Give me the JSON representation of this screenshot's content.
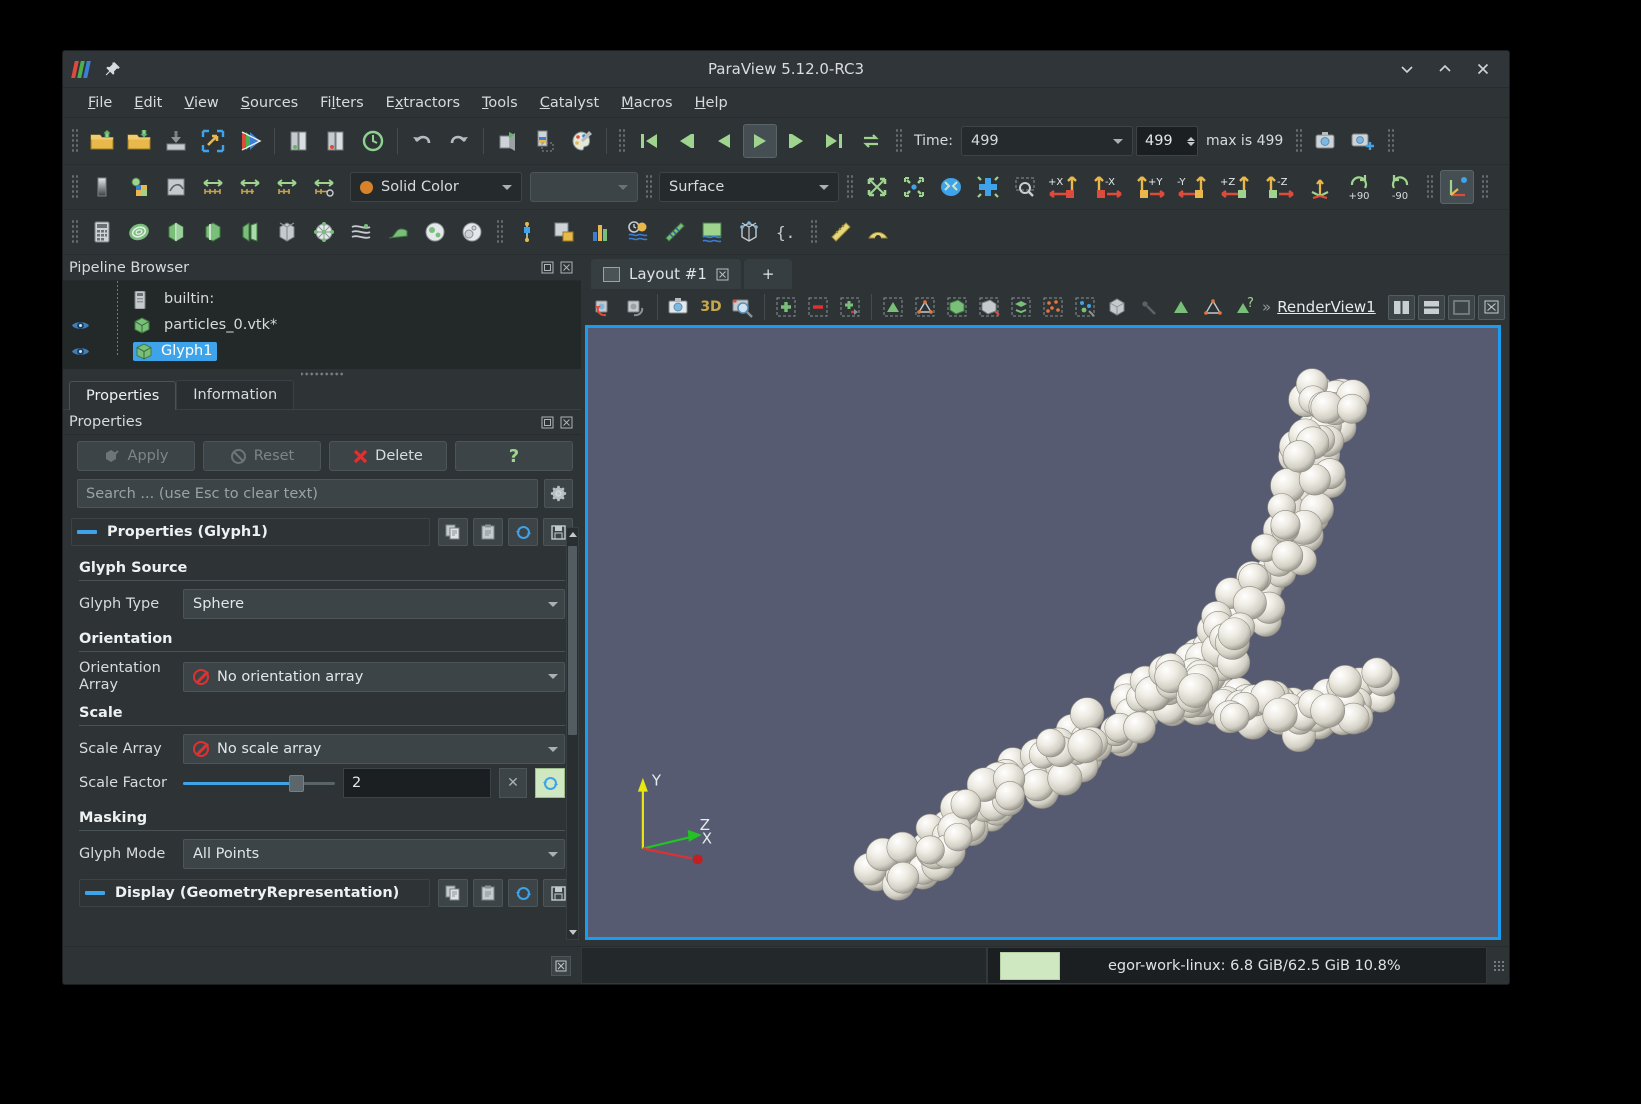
{
  "window": {
    "title": "ParaView 5.12.0-RC3",
    "logo_colors": [
      "#e04a3a",
      "#4bb050",
      "#3a7fd5"
    ],
    "pin_icon": "pin-icon",
    "controls": [
      {
        "name": "minimize-button",
        "glyph": "⌵"
      },
      {
        "name": "maximize-button",
        "glyph": "⌃"
      },
      {
        "name": "close-button",
        "glyph": "✕"
      }
    ]
  },
  "menubar": {
    "items": [
      {
        "label": "File",
        "mnemonic": "F"
      },
      {
        "label": "Edit",
        "mnemonic": "E"
      },
      {
        "label": "View",
        "mnemonic": "V"
      },
      {
        "label": "Sources",
        "mnemonic": "S"
      },
      {
        "label": "Filters",
        "mnemonic": "l"
      },
      {
        "label": "Extractors",
        "mnemonic": "x"
      },
      {
        "label": "Tools",
        "mnemonic": "T"
      },
      {
        "label": "Catalyst",
        "mnemonic": "C"
      },
      {
        "label": "Macros",
        "mnemonic": "M"
      },
      {
        "label": "Help",
        "mnemonic": "H"
      }
    ]
  },
  "toolbar_main": {
    "buttons": [
      "open-file-icon",
      "save-state-icon",
      "load-state-icon",
      "auto-apply-icon",
      "paraview-connect-icon",
      "connect-server-icon",
      "disconnect-server-icon",
      "reset-session-icon",
      "undo-icon",
      "redo-icon",
      "camera-undo-icon",
      "extract-selection-icon",
      "color-palette-icon"
    ],
    "vcr": [
      "first-frame-icon",
      "previous-frame-icon",
      "play-reverse-icon",
      "play-icon",
      "next-frame-icon",
      "last-frame-icon",
      "loop-icon"
    ],
    "time_label": "Time:",
    "time_value": "499",
    "frame_value": "499",
    "max_label": "max is 499",
    "right_buttons": [
      "screenshot-icon",
      "capture-all-views-icon"
    ]
  },
  "toolbar_repr": {
    "left_buttons": [
      "color-legend-icon",
      "edit-color-map-icon",
      "rescale-custom-icon",
      "rescale-data-range-icon",
      "rescale-to-custom-icon",
      "rescale-visible-icon",
      "rescale-temporal-icon"
    ],
    "color_by": "Solid Color",
    "color_by_icon": "solid-color-dot-icon",
    "array_component": "",
    "representation": "Surface",
    "camera_buttons": [
      "reset-camera-icon",
      "zoom-to-data-icon",
      "reset-closest-icon",
      "zoom-to-box-icon",
      "zoom-closest-icon",
      "pos-x-icon",
      "neg-x-icon",
      "pos-y-icon",
      "neg-y-icon",
      "pos-z-icon",
      "neg-z-icon",
      "isometric-icon"
    ],
    "rotate_labels": [
      "+90",
      "-90"
    ],
    "axes_toggle": "show-center-axes-icon"
  },
  "toolbar_filters": {
    "buttons": [
      "calculator-icon",
      "contour-icon",
      "clip-icon",
      "slice-icon",
      "threshold-icon",
      "extract-subset-icon",
      "glyph-icon",
      "stream-tracer-icon",
      "warp-icon",
      "group-datasets-icon",
      "extract-level-icon",
      "plot-over-line-icon",
      "plot-selection-icon",
      "histogram-icon",
      "annotate-time-icon",
      "gradient-icon",
      "plot-data-icon",
      "axes-grid-icon",
      "python-calculator-icon",
      "ruler-icon",
      "protractor-icon"
    ]
  },
  "pipeline": {
    "title": "Pipeline Browser",
    "dock_icons": [
      "float-icon",
      "close-icon"
    ],
    "items": [
      {
        "label": "builtin:",
        "icon": "server-icon",
        "eye": false,
        "selected": false
      },
      {
        "label": "particles_0.vtk*",
        "icon": "dataset-icon",
        "eye": true,
        "selected": false
      },
      {
        "label": "Glyph1",
        "icon": "dataset-icon",
        "eye": true,
        "selected": true
      }
    ]
  },
  "panel_tabs": [
    {
      "label": "Properties",
      "active": true
    },
    {
      "label": "Information",
      "active": false
    }
  ],
  "properties": {
    "title": "Properties",
    "dock_icons": [
      "float-icon",
      "close-icon"
    ],
    "buttons": {
      "apply": "Apply",
      "reset": "Reset",
      "delete": "Delete",
      "help": "?"
    },
    "search_placeholder": "Search ... (use Esc to clear text)",
    "gear_icon": "gear-icon",
    "group_title": "Properties (Glyph1)",
    "group_buttons": [
      "copy-icon",
      "paste-icon",
      "restore-defaults-icon",
      "save-defaults-icon"
    ],
    "sections": [
      {
        "title": "Glyph Source",
        "rows": [
          {
            "label": "Glyph Type",
            "type": "combo",
            "value": "Sphere"
          }
        ]
      },
      {
        "title": "Orientation",
        "rows": [
          {
            "label": "Orientation Array",
            "type": "combo-noarray",
            "value": "No orientation array"
          }
        ]
      },
      {
        "title": "Scale",
        "rows": [
          {
            "label": "Scale Array",
            "type": "combo-noarray",
            "value": "No scale array"
          },
          {
            "label": "Scale Factor",
            "type": "slider",
            "value": "2"
          }
        ]
      },
      {
        "title": "Masking",
        "rows": [
          {
            "label": "Glyph Mode",
            "type": "combo",
            "value": "All Points"
          }
        ]
      }
    ],
    "display_group_title": "Display (GeometryRepresentation)",
    "display_group_buttons": [
      "copy-icon",
      "paste-icon",
      "restore-defaults-icon",
      "save-defaults-icon"
    ]
  },
  "layout": {
    "tabs": [
      {
        "label": "Layout #1",
        "close": "⌧",
        "active": true
      }
    ],
    "add_tab": "+"
  },
  "view": {
    "toolbar_buttons": [
      "undo-camera-icon",
      "redo-camera-icon",
      "screenshot-view-icon",
      "3D",
      "zoom-region-icon",
      "select-cells-icon",
      "deselect-icon",
      "select-points-through-icon",
      "select-cells-surface-icon",
      "select-points-surface-icon",
      "select-frustum-cells-icon",
      "select-frustum-points-icon",
      "select-blocks-icon",
      "interactive-select-cells-icon",
      "interactive-select-points-icon",
      "hover-cells-icon",
      "select-block-icon",
      "hover-points-icon",
      "select-point-icon",
      "select-polygon-icon",
      "selection-help-icon"
    ],
    "name": "RenderView1",
    "split_buttons": [
      "split-horizontal-icon",
      "split-vertical-icon",
      "maximize-view-icon",
      "close-view-icon"
    ],
    "background_color": "#565b72",
    "border_color": "#1a9cf0",
    "axes": [
      {
        "label": "Y",
        "color": "#e8e80f"
      },
      {
        "label": "Z",
        "color": "#22c322"
      },
      {
        "label": "X",
        "color": "#e03131"
      }
    ],
    "scene_description": "Sphere glyph particle cluster, off-white spheres on slate background"
  },
  "statusbar": {
    "memory_text": "egor-work-linux: 6.8 GiB/62.5 GiB 10.8%",
    "memory_bar_color": "#cfe8c2",
    "memory_percent": 10.8
  }
}
